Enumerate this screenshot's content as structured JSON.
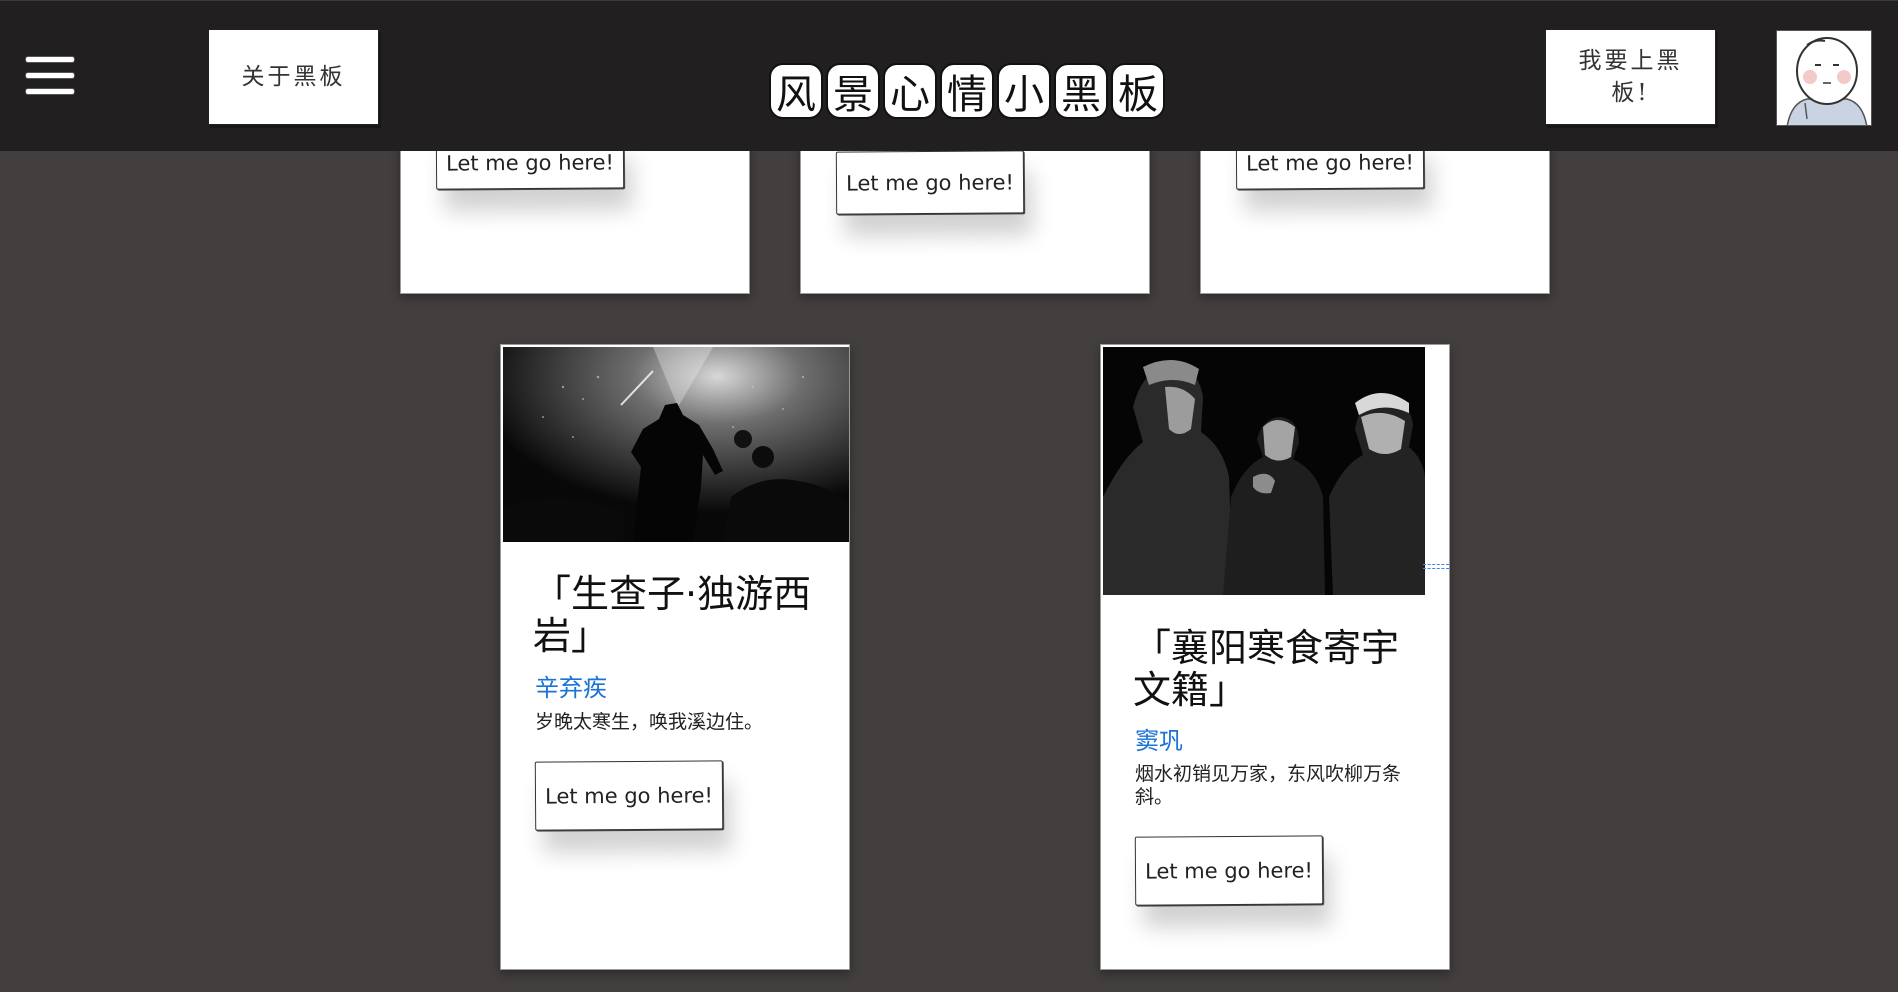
{
  "header": {
    "menu_icon": "hamburger-menu-icon",
    "about_label": "关于黑板",
    "site_title_chars": [
      "风",
      "景",
      "心",
      "情",
      "小",
      "黑",
      "板"
    ],
    "join_label": "我要上黑板!",
    "avatar_icon": "cartoon-face-avatar-icon"
  },
  "top_cards": [
    {
      "button_label": "Let me go here!"
    },
    {
      "button_label": "Let me go here!"
    },
    {
      "button_label": "Let me go here!"
    }
  ],
  "cards": [
    {
      "title": "「生查子·独游西岩」",
      "author": "辛弃疾",
      "excerpt": "岁晚太寒生，唤我溪边住。",
      "button_label": "Let me go here!",
      "image": "concert-silhouette-photo"
    },
    {
      "title": "「襄阳寒食寄宇文籍」",
      "author": "窦巩",
      "excerpt": "烟水初销见万家，东风吹柳万条斜。",
      "button_label": "Let me go here!",
      "image": "three-men-portrait-photo"
    }
  ],
  "colors": {
    "page_background": "#433f3f",
    "header_background": "#211f20",
    "author_link": "#1a73d6",
    "card_background": "#ffffff"
  }
}
